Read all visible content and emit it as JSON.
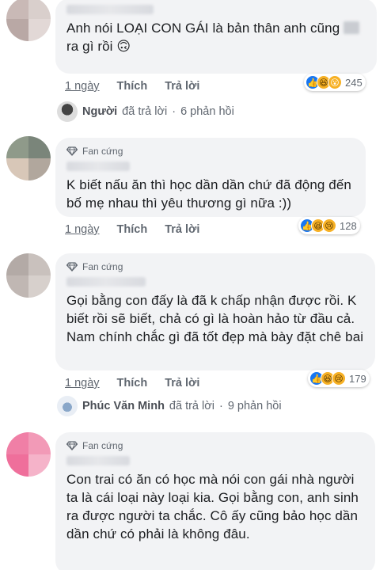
{
  "comments": [
    {
      "badge": "",
      "text_before": "Anh nói LOẠI CON GÁI là bản thân anh cũng ",
      "text_after": "ra gì rồi ",
      "emoji": "🙃",
      "time": "1 ngày",
      "like": "Thích",
      "reply": "Trả lời",
      "reaction_count": "245",
      "replies": {
        "who": "Người",
        "label": "đã trả lời",
        "sep": "·",
        "count": "6 phản hồi"
      }
    },
    {
      "badge": "Fan cứng",
      "text": "K biết nấu ăn thì học dần dần chứ đã động đến bố mẹ nhau thì yêu thương gì nữa :))",
      "time": "1 ngày",
      "like": "Thích",
      "reply": "Trả lời",
      "reaction_count": "128"
    },
    {
      "badge": "Fan cứng",
      "text": "Gọi bằng con đấy là đã k chấp nhận được rồi. K biết rồi sẽ biết, chả có gì là hoàn hảo từ đầu cả. Nam chính chắc gì đã tốt đẹp mà bày đặt chê bai",
      "time": "1 ngày",
      "like": "Thích",
      "reply": "Trả lời",
      "reaction_count": "179",
      "replies": {
        "who": "Phúc Văn Minh",
        "label": "đã trả lời",
        "sep": "·",
        "count": "9 phản hồi"
      }
    },
    {
      "badge": "Fan cứng",
      "text": "Con trai có ăn có học mà nói con gái nhà người ta là cái loại này loại kia. Gọi bằng con, anh sinh ra được người ta chắc. Cô ấy cũng bảo học dần dần chứ có phải là không đâu."
    }
  ],
  "colors": {
    "like": "#1877f2",
    "haha": "#f7b125",
    "bubble": "#f2f3f5",
    "meta": "#606770"
  },
  "icons": [
    "diamond-icon",
    "like-reaction-icon",
    "haha-reaction-icon",
    "sad-reaction-icon"
  ]
}
